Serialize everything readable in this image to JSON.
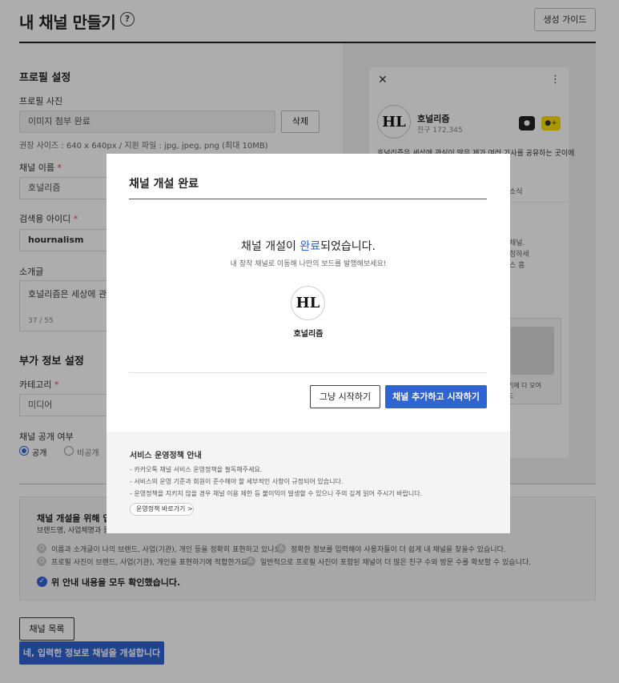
{
  "page": {
    "title": "내 채널 만들기",
    "help_glyph": "?",
    "guide_button": "생성 가이드"
  },
  "profile": {
    "section_title": "프로필 설정",
    "photo_label": "프로필 사진",
    "photo_value": "이미지 첨부 완료",
    "delete_button": "삭제",
    "photo_hint": "권장 사이즈 : 640 x 640px / 지원 파일 : jpg, jpeg, png (최대 10MB)",
    "name_label": "채널 이름",
    "name_value": "호널리즘",
    "search_id_label": "검색용 아이디",
    "search_id_value": "hournalism",
    "intro_label": "소개글",
    "intro_value": "호널리즘은 세상에 관심",
    "intro_count": "37 / 55",
    "required_mark": "*"
  },
  "extra": {
    "section_title": "부가 정보 설정",
    "category_label": "카테고리",
    "category_value": "미디어",
    "visibility_label": "채널 공개 여부",
    "visibility_public": "공개",
    "visibility_private": "비공개"
  },
  "preview": {
    "close_glyph": "✕",
    "more_glyph": "⋮",
    "channel_name": "호널리즘",
    "friends": "친구 172,345",
    "desc": "호널리즘은 세상에 관심이 많은 제가 여러 기사를 공유하는 곳이에",
    "tab_news": "소식",
    "frag1": "채널.",
    "frag2": "정하세",
    "frag3": "스 홈",
    "frag4": "기에 다 모여",
    "frag5": "드"
  },
  "logo_text": "HL",
  "notice": {
    "title": "채널 개설을 위해 입력",
    "sub": "브랜드명, 사업체명과 동",
    "q1": "이름과 소개글이 나의 브랜드, 사업(기관), 개인 등을 정확히 표현하고 있나요?",
    "a1": "정확한 정보를 입력해야 사용자들이 더 쉽게 내 채널을 찾을수 있습니다.",
    "q2": "프로필 사진이 브랜드, 사업(기관), 개인을 표현하기에 적합한가요?",
    "a2": "일반적으로 프로필 사진이 포함된 채널이 더 많은 친구 수와 방문 수를 확보할 수 있습니다.",
    "confirm": "위 안내 내용을 모두 확인했습니다."
  },
  "footer": {
    "list_button": "채널 목록",
    "create_button": "네, 입력한 정보로 채널을 개설합니다"
  },
  "modal": {
    "title": "채널 개설 완료",
    "msg_pre": "채널 개설이 ",
    "msg_highlight": "완료",
    "msg_post": "되었습니다.",
    "sub": "내 창작 채널로 이동해 나만의 보드를 발행해보세요!",
    "channel_name": "호널리즘",
    "skip_button": "그냥 시작하기",
    "start_button": "채널 추가하고 시작하기",
    "policy_title": "서비스 운영정책 안내",
    "policy_1": "- 카카오톡 채널 서비스 운영정책을 필독해주세요.",
    "policy_2": "- 서비스의 운영 기준과 회원이 준수해야 할 세부적인 사항이 규정되어 있습니다.",
    "policy_3": "- 운영정책을 지키지 않을 경우 채널 이용 제한 등 불이익이 발생할 수 있으니 주의 깊게 읽어 주시기 바랍니다.",
    "policy_link": "운영정책 바로가기 >"
  },
  "colors": {
    "accent": "#3064cf",
    "highlight": "#2f63cf",
    "kakao_yellow": "#f9e000"
  }
}
